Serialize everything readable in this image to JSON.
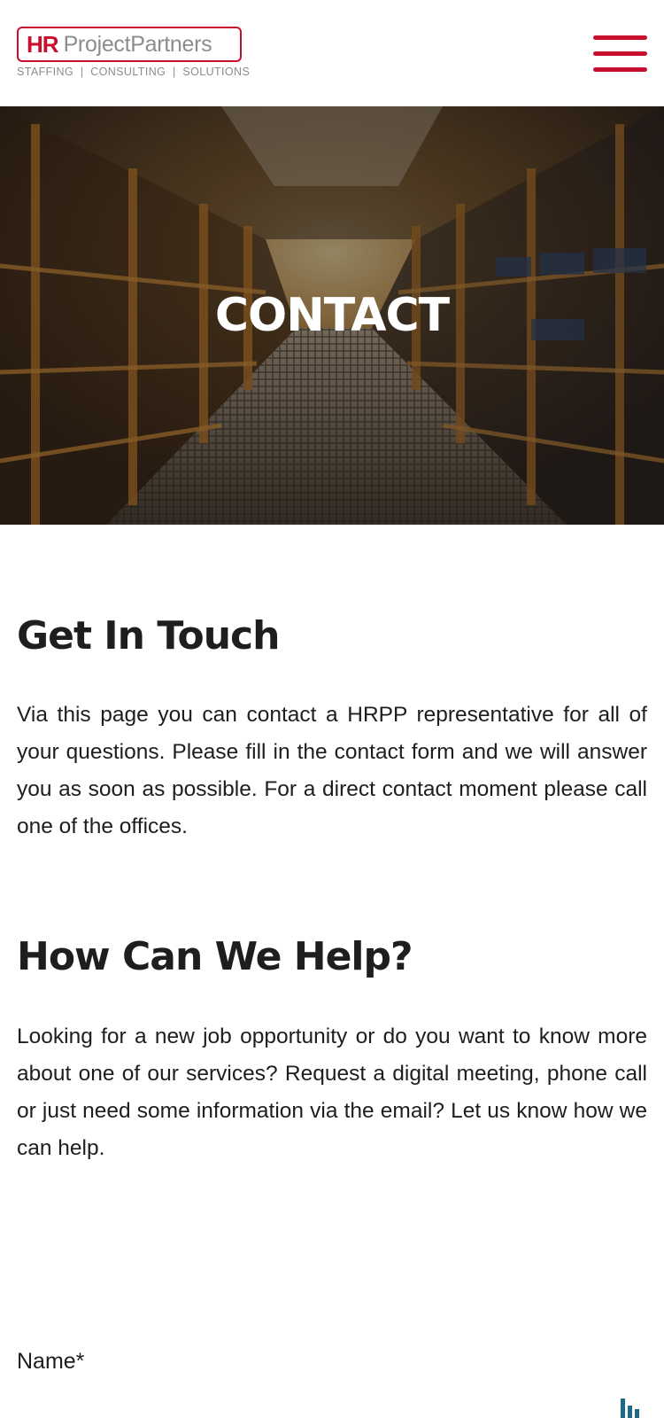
{
  "header": {
    "logo_hr": "HR",
    "logo_name": "ProjectPartners",
    "logo_tagline": "STAFFING  |  CONSULTING  |  SOLUTIONS",
    "menu_icon": "hamburger-menu-icon",
    "brand_color": "#c8102e"
  },
  "hero": {
    "title": "CONTACT",
    "background": "industrial-walkway-photo"
  },
  "sections": {
    "get_in_touch": {
      "heading": "Get In Touch",
      "text": "Via this page you can contact a HRPP representative for all of your questions. Please fill in the contact form and we will answer you as soon as possible. For a direct contact moment please call one of the offices."
    },
    "how_can_we_help": {
      "heading": "How Can We Help?",
      "text": "Looking for a new job opportunity or do you want to know more about one of our services? Request a digital meeting, phone call or just need some information via the email? Let us know how we can help."
    }
  },
  "form": {
    "name_label": "Name*"
  },
  "accent_colors": {
    "text": "#1e1e1e",
    "corner_icon": "#1d6a86"
  }
}
